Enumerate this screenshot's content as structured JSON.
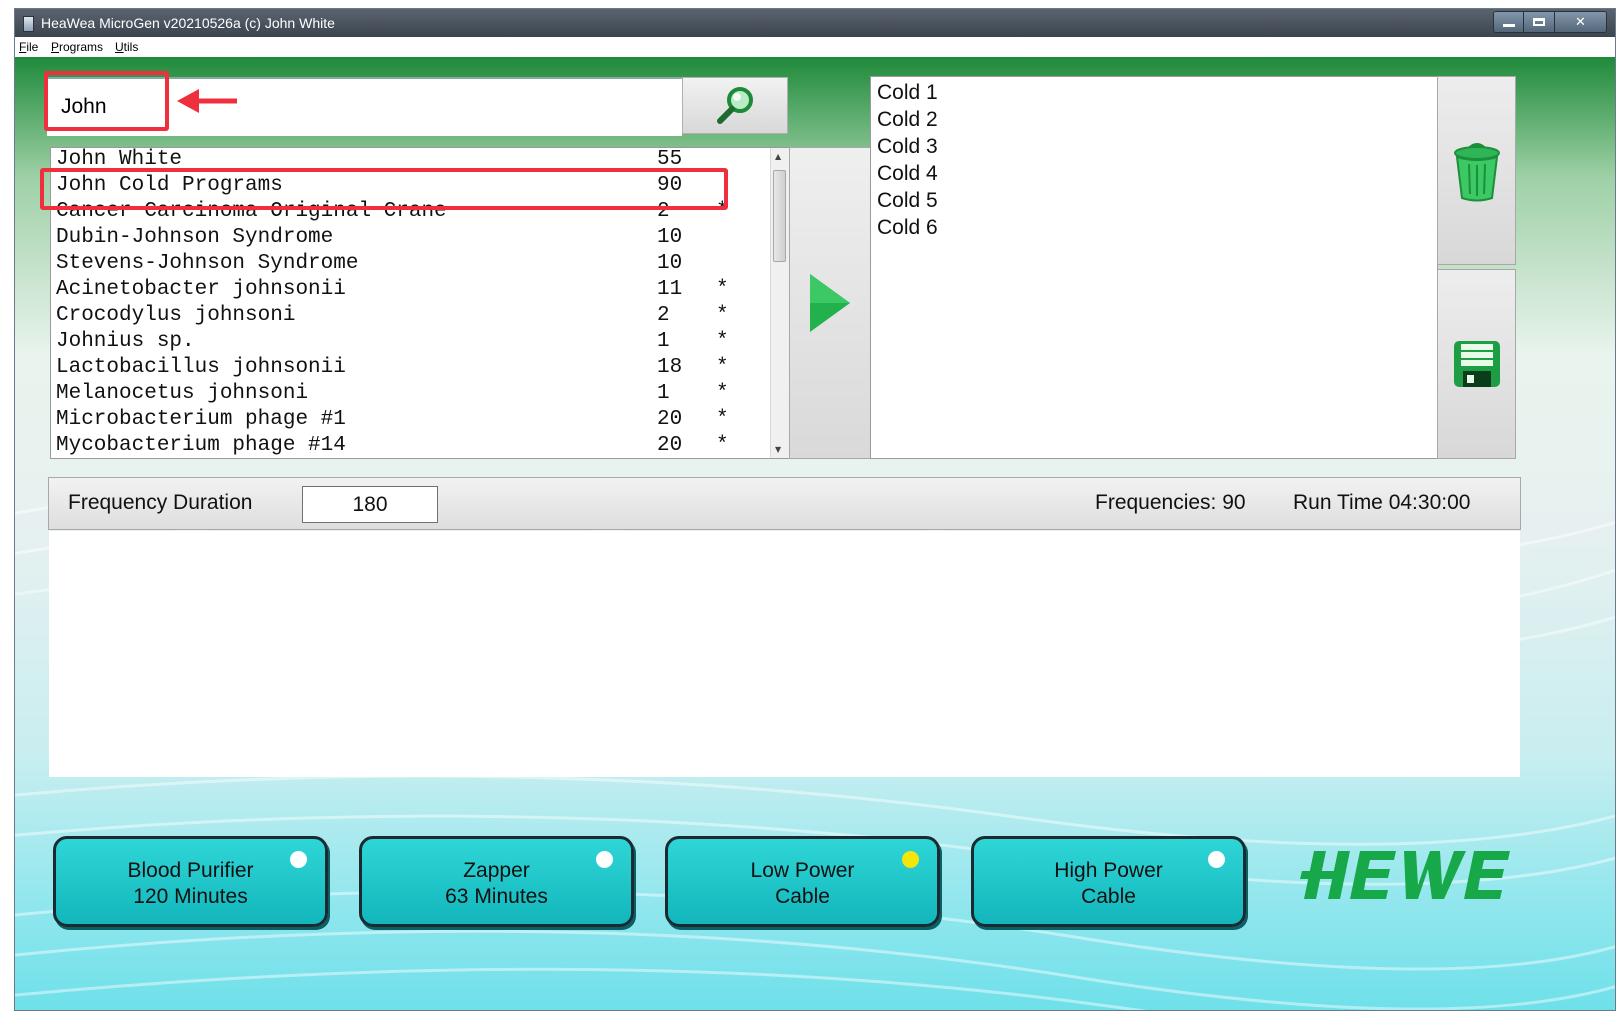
{
  "window": {
    "title": "HeaWea MicroGen v20210526a (c) John White"
  },
  "menu": [
    "File",
    "Programs",
    "Utils"
  ],
  "search": {
    "value": "John"
  },
  "results": [
    {
      "name": "John White",
      "count": "55",
      "star": ""
    },
    {
      "name": "John Cold Programs",
      "count": "90",
      "star": ""
    },
    {
      "name": "Cancer Carcinoma Original Crane",
      "count": "2",
      "star": "*"
    },
    {
      "name": "Dubin-Johnson Syndrome",
      "count": "10",
      "star": ""
    },
    {
      "name": "Stevens-Johnson Syndrome",
      "count": "10",
      "star": ""
    },
    {
      "name": "Acinetobacter johnsonii",
      "count": "11",
      "star": "*"
    },
    {
      "name": "Crocodylus johnsoni",
      "count": "2",
      "star": "*"
    },
    {
      "name": "Johnius sp.",
      "count": "1",
      "star": "*"
    },
    {
      "name": "Lactobacillus johnsonii",
      "count": "18",
      "star": "*"
    },
    {
      "name": "Melanocetus johnsoni",
      "count": "1",
      "star": "*"
    },
    {
      "name": "Microbacterium phage #1",
      "count": "20",
      "star": "*"
    },
    {
      "name": "Mycobacterium phage #14",
      "count": "20",
      "star": "*"
    }
  ],
  "program_list": [
    "Cold 1",
    "Cold 2",
    "Cold 3",
    "Cold 4",
    "Cold 5",
    "Cold 6"
  ],
  "info": {
    "duration_label": "Frequency Duration",
    "duration_value": "180",
    "frequencies": "Frequencies: 90",
    "run_time": "Run Time 04:30:00"
  },
  "modes": [
    {
      "line1": "Blood Purifier",
      "line2": "120 Minutes",
      "led": "#ffffff"
    },
    {
      "line1": "Zapper",
      "line2": "63 Minutes",
      "led": "#ffffff"
    },
    {
      "line1": "Low Power",
      "line2": "Cable",
      "led": "#f2e60a"
    },
    {
      "line1": "High Power",
      "line2": "Cable",
      "led": "#ffffff"
    }
  ],
  "colors": {
    "annotation": "#ef2e3e",
    "accent_green": "#22b14c",
    "button_cyan": "#1fc8cc",
    "logo_green": "#17a84a"
  },
  "icons": {
    "search": "magnifier-icon",
    "add": "play-arrow-icon",
    "delete": "trash-icon",
    "save": "floppy-disk-icon"
  }
}
